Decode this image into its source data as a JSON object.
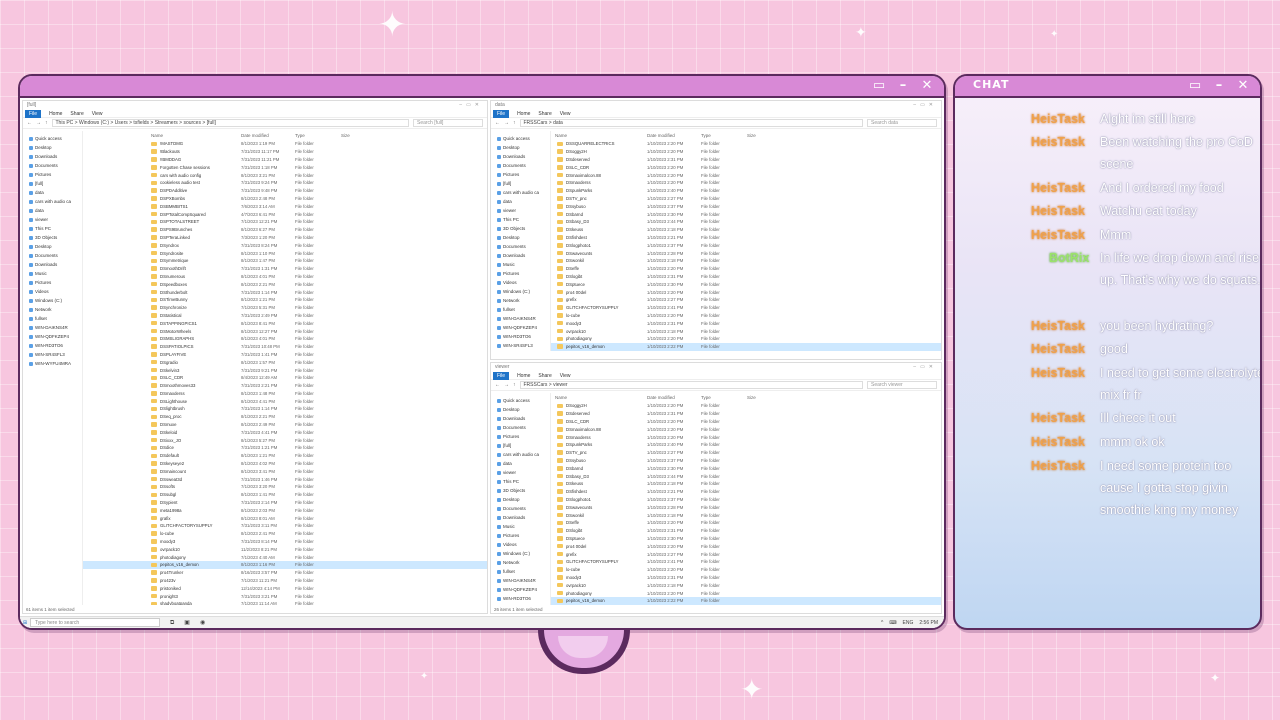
{
  "sparkles": [
    "✦",
    "✦",
    "✦",
    "✦",
    "✦",
    "✦"
  ],
  "screen_frame": {
    "buttons": [
      "▭",
      "–",
      "✕"
    ]
  },
  "chat_frame": {
    "title": "CHAT",
    "buttons": [
      "▭",
      "–",
      "✕"
    ]
  },
  "colors": {
    "username": "#f0a24a",
    "bot_username": "#9be36b",
    "frame": "#5b2a5e",
    "titlebar": "#d889d6",
    "background": "#f7c6df"
  },
  "left_explorer": {
    "title": "[full]",
    "ribbon": {
      "file": "File",
      "tabs": [
        "Home",
        "Share",
        "View"
      ]
    },
    "path": "This PC > Windows (C:) > Users > tsfields > Streamers > sources > [full]",
    "search": "Search [full]",
    "columns": {
      "name": "Name",
      "date": "Date modified",
      "type": "Type",
      "size": "Size"
    },
    "nav": [
      "Quick access",
      "Desktop",
      "Downloads",
      "Documents",
      "Pictures",
      "[full]",
      "data",
      "cars with audio ca",
      "data",
      "viewer",
      "This PC",
      "3D Objects",
      "Desktop",
      "Documents",
      "Downloads",
      "Music",
      "Pictures",
      "Videos",
      "Windows (C:)",
      "Network",
      "fullset",
      "WIN-DAIKNS4R",
      "WIN-QDFKZEP4",
      "WIN-RD3TO6",
      "WIN-SR4SFL3",
      "WIN-WYFU4MRA"
    ],
    "rows": [
      {
        "name": "!MASTDMG",
        "date": "8/1/2023 1:19 PM",
        "type": "File folder"
      },
      {
        "name": "!Blackouts",
        "date": "7/31/2023 11:17 PM",
        "type": "File folder"
      },
      {
        "name": "!!BMDDAG",
        "date": "7/31/2023 11:21 PM",
        "type": "File folder"
      },
      {
        "name": "Forgotten Chase sessions",
        "date": "7/31/2023 1:18 PM",
        "type": "File folder"
      },
      {
        "name": "cars with audio config",
        "date": "8/1/2023 3:21 PM",
        "type": "File folder"
      },
      {
        "name": "cookieless audio test",
        "date": "7/31/2023 9:24 PM",
        "type": "File folder"
      },
      {
        "name": "DSPDAdditive",
        "date": "7/31/2023 9:48 PM",
        "type": "File folder"
      },
      {
        "name": "DSPXBombs",
        "date": "8/1/2023 2:48 PM",
        "type": "File folder"
      },
      {
        "name": "DSBMMBITS1",
        "date": "7/6/2023 3:14 AM",
        "type": "File folder"
      },
      {
        "name": "DSPTotalCompSquared",
        "date": "4/7/2023 6:41 PM",
        "type": "File folder"
      },
      {
        "name": "DSPTOTALSTREET",
        "date": "7/1/2023 12:21 PM",
        "type": "File folder"
      },
      {
        "name": "DSPS9Brunches",
        "date": "8/1/2023 6:27 PM",
        "type": "File folder"
      },
      {
        "name": "DSPTeraLinked",
        "date": "7/3/2023 1:20 PM",
        "type": "File folder"
      },
      {
        "name": "DSyndrox",
        "date": "7/31/2023 8:24 PM",
        "type": "File folder"
      },
      {
        "name": "DSyndrosite",
        "date": "8/1/2023 1:10 PM",
        "type": "File folder"
      },
      {
        "name": "DSymmetrique",
        "date": "8/1/2023 1:47 PM",
        "type": "File folder"
      },
      {
        "name": "DSmoothDrift",
        "date": "7/31/2023 1:31 PM",
        "type": "File folder"
      },
      {
        "name": "DSnumerous",
        "date": "8/1/2023 4:01 PM",
        "type": "File folder"
      },
      {
        "name": "DSpeedboxes",
        "date": "8/1/2023 2:21 PM",
        "type": "File folder"
      },
      {
        "name": "DSthunderbolt",
        "date": "7/31/2023 1:14 PM",
        "type": "File folder"
      },
      {
        "name": "DSTimeBunny",
        "date": "8/1/2023 1:21 PM",
        "type": "File folder"
      },
      {
        "name": "DSynchronize",
        "date": "7/1/2023 5:31 PM",
        "type": "File folder"
      },
      {
        "name": "DStatistical",
        "date": "7/31/2023 2:49 PM",
        "type": "File folder"
      },
      {
        "name": "DSTAPPINGPICS1",
        "date": "8/1/2023 8:41 PM",
        "type": "File folder"
      },
      {
        "name": "DSMotorWheels",
        "date": "8/1/2023 12:27 PM",
        "type": "File folder"
      },
      {
        "name": "DSMSLIGRAPHS",
        "date": "8/1/2023 4:01 PM",
        "type": "File folder"
      },
      {
        "name": "DSSPATIOLPICS",
        "date": "7/31/2023 10:48 PM",
        "type": "File folder"
      },
      {
        "name": "DSPLAYFIVE",
        "date": "7/31/2023 1:41 PM",
        "type": "File folder"
      },
      {
        "name": "DSgradio",
        "date": "8/1/2023 1:57 PM",
        "type": "File folder"
      },
      {
        "name": "DSkelvin3",
        "date": "7/31/2023 9:21 PM",
        "type": "File folder"
      },
      {
        "name": "DSLC_CDR",
        "date": "8/4/2023 12:49 AM",
        "type": "File folder"
      },
      {
        "name": "DSmoothmoves33",
        "date": "7/31/2023 2:21 PM",
        "type": "File folder"
      },
      {
        "name": "DSmaxderss",
        "date": "8/1/2023 1:48 PM",
        "type": "File folder"
      },
      {
        "name": "DSLighthouse",
        "date": "8/1/2023 4:41 PM",
        "type": "File folder"
      },
      {
        "name": "DSlightbrush",
        "date": "7/31/2023 1:14 PM",
        "type": "File folder"
      },
      {
        "name": "DSeq_proc",
        "date": "8/1/2023 2:21 PM",
        "type": "File folder"
      },
      {
        "name": "DSmuxe",
        "date": "8/1/2023 2:49 PM",
        "type": "File folder"
      },
      {
        "name": "DSkeloid",
        "date": "7/31/2023 4:41 PM",
        "type": "File folder"
      },
      {
        "name": "DSixxx_JO",
        "date": "8/1/2023 5:27 PM",
        "type": "File folder"
      },
      {
        "name": "DSdice",
        "date": "7/31/2023 1:21 PM",
        "type": "File folder"
      },
      {
        "name": "DSdefault",
        "date": "8/1/2023 1:21 PM",
        "type": "File folder"
      },
      {
        "name": "DSkeyseye2",
        "date": "8/1/2023 4:02 PM",
        "type": "File folder"
      },
      {
        "name": "DSmaincount",
        "date": "8/1/2023 3:41 PM",
        "type": "File folder"
      },
      {
        "name": "DSsweat3d",
        "date": "7/31/2023 1:46 PM",
        "type": "File folder"
      },
      {
        "name": "DSsofts",
        "date": "7/1/2023 3:20 PM",
        "type": "File folder"
      },
      {
        "name": "DSsubgl",
        "date": "8/1/2023 1:41 PM",
        "type": "File folder"
      },
      {
        "name": "DSypient",
        "date": "7/31/2023 2:14 PM",
        "type": "File folder"
      },
      {
        "name": "meta1998a",
        "date": "8/1/2023 2:03 PM",
        "type": "File folder"
      },
      {
        "name": "grafix",
        "date": "8/1/2023 8:01 AM",
        "type": "File folder"
      },
      {
        "name": "GLITCHFACTORYSUPPLY",
        "date": "7/31/2023 3:11 PM",
        "type": "File folder"
      },
      {
        "name": "lo-cube",
        "date": "8/1/2023 2:41 PM",
        "type": "File folder"
      },
      {
        "name": "moody3",
        "date": "7/31/2023 8:14 PM",
        "type": "File folder"
      },
      {
        "name": "ovrpack10",
        "date": "11/2/2023 8:21 PM",
        "type": "File folder"
      },
      {
        "name": "photodiagony",
        "date": "7/1/2023 4:40 AM",
        "type": "File folder"
      },
      {
        "name": "pepitos_v16_demon",
        "date": "8/1/2023 1:16 PM",
        "type": "File folder",
        "selected": true
      },
      {
        "name": "pro4Trunker",
        "date": "8/16/2023 3:57 PM",
        "type": "File folder"
      },
      {
        "name": "pro423v",
        "date": "7/1/2023 11:21 PM",
        "type": "File folder"
      },
      {
        "name": "pristoniked",
        "date": "12/14/2023 4:14 PM",
        "type": "File folder"
      },
      {
        "name": "pronight3",
        "date": "7/31/2023 3:21 PM",
        "type": "File folder"
      },
      {
        "name": "shadyboatpanda",
        "date": "7/1/2023 11:14 AM",
        "type": "File folder"
      }
    ],
    "status": "61 items   1 item selected"
  },
  "right_top_explorer": {
    "title": "data",
    "ribbon": {
      "file": "File",
      "tabs": [
        "Home",
        "Share",
        "View"
      ]
    },
    "path": "FRSSCars > data",
    "search": "Search data",
    "columns": {
      "name": "Name",
      "date": "Date modified",
      "type": "Type",
      "size": "Size"
    },
    "nav": [
      "Quick access",
      "Desktop",
      "Downloads",
      "Documents",
      "Pictures",
      "[full]",
      "cars with audio ca",
      "data",
      "viewer",
      "This PC",
      "3D Objects",
      "Desktop",
      "Documents",
      "Downloads",
      "Music",
      "Pictures",
      "Videos",
      "Windows (C:)",
      "Network",
      "fullset",
      "WIN-DAIKNS4R",
      "WIN-QDFKZEP4",
      "WIN-RD3TO6",
      "WIN-SR4SFL3"
    ],
    "rows": [
      {
        "name": "DSSQUARRELECTRICS",
        "date": "1/10/2023 2:20 PM",
        "type": "File folder"
      },
      {
        "name": "DSoggy2H",
        "date": "1/10/2023 2:20 PM",
        "type": "File folder"
      },
      {
        "name": "DSdeserved",
        "date": "1/10/2023 2:31 PM",
        "type": "File folder"
      },
      {
        "name": "DSLC_CDR",
        "date": "1/10/2023 2:20 PM",
        "type": "File folder"
      },
      {
        "name": "DSmaximalcon.88",
        "date": "1/10/2023 2:20 PM",
        "type": "File folder"
      },
      {
        "name": "DSmaxderss",
        "date": "1/10/2023 2:20 PM",
        "type": "File folder"
      },
      {
        "name": "DSpunkParks",
        "date": "1/10/2023 2:40 PM",
        "type": "File folder"
      },
      {
        "name": "DSTV_pnc",
        "date": "1/10/2023 2:27 PM",
        "type": "File folder"
      },
      {
        "name": "DSsybuso",
        "date": "1/10/2023 2:37 PM",
        "type": "File folder"
      },
      {
        "name": "DSbarnd",
        "date": "1/10/2023 2:30 PM",
        "type": "File folder"
      },
      {
        "name": "DSbasy_D3",
        "date": "1/10/2023 2:44 PM",
        "type": "File folder"
      },
      {
        "name": "DSkeuss",
        "date": "1/10/2023 2:18 PM",
        "type": "File folder"
      },
      {
        "name": "DSfishdest",
        "date": "1/10/2023 2:21 PM",
        "type": "File folder"
      },
      {
        "name": "DSlogphoto1",
        "date": "1/10/2023 2:37 PM",
        "type": "File folder"
      },
      {
        "name": "DSwavecunts",
        "date": "1/10/2023 2:28 PM",
        "type": "File folder"
      },
      {
        "name": "DSwonkil",
        "date": "1/10/2023 2:18 PM",
        "type": "File folder"
      },
      {
        "name": "DSeffe",
        "date": "1/10/2023 2:20 PM",
        "type": "File folder"
      },
      {
        "name": "DSlogibt",
        "date": "1/10/2023 2:31 PM",
        "type": "File folder"
      },
      {
        "name": "DSptuece",
        "date": "1/10/2023 2:30 PM",
        "type": "File folder"
      },
      {
        "name": "pro4 00del",
        "date": "1/10/2023 2:20 PM",
        "type": "File folder"
      },
      {
        "name": "grefix",
        "date": "1/10/2023 2:27 PM",
        "type": "File folder"
      },
      {
        "name": "GLITCHFACTORYSUPPLY",
        "date": "1/10/2023 2:41 PM",
        "type": "File folder"
      },
      {
        "name": "lo-cube",
        "date": "1/10/2023 2:20 PM",
        "type": "File folder"
      },
      {
        "name": "moody3",
        "date": "1/10/2023 2:31 PM",
        "type": "File folder"
      },
      {
        "name": "ovrpack10",
        "date": "1/10/2023 2:18 PM",
        "type": "File folder"
      },
      {
        "name": "photodiagony",
        "date": "1/10/2023 2:20 PM",
        "type": "File folder"
      },
      {
        "name": "pepitos_v16_demon",
        "date": "1/10/2023 2:22 PM",
        "type": "File folder",
        "selected": true
      }
    ]
  },
  "right_bottom_explorer": {
    "title": "viewer",
    "ribbon": {
      "file": "File",
      "tabs": [
        "Home",
        "Share",
        "View"
      ]
    },
    "path": "FRSSCars > viewer",
    "search": "Search viewer",
    "columns": {
      "name": "Name",
      "date": "Date modified",
      "type": "Type",
      "size": "Size"
    },
    "nav": [
      "Quick access",
      "Desktop",
      "Downloads",
      "Documents",
      "Pictures",
      "[full]",
      "cars with audio ca",
      "data",
      "viewer",
      "This PC",
      "3D Objects",
      "Desktop",
      "Documents",
      "Downloads",
      "Music",
      "Pictures",
      "Videos",
      "Windows (C:)",
      "Network",
      "fullset",
      "WIN-DAIKNS4R",
      "WIN-QDFKZEP4",
      "WIN-RD3TO6"
    ],
    "rows": [
      {
        "name": "DSoggy2H",
        "date": "1/10/2023 2:20 PM",
        "type": "File folder"
      },
      {
        "name": "DSdeserved",
        "date": "1/10/2023 2:31 PM",
        "type": "File folder"
      },
      {
        "name": "DSLC_CDR",
        "date": "1/10/2023 2:20 PM",
        "type": "File folder"
      },
      {
        "name": "DSmaximalcon.88",
        "date": "1/10/2023 2:20 PM",
        "type": "File folder"
      },
      {
        "name": "DSmaxderss",
        "date": "1/10/2023 2:20 PM",
        "type": "File folder"
      },
      {
        "name": "DSpunkParks",
        "date": "1/10/2023 2:40 PM",
        "type": "File folder"
      },
      {
        "name": "DSTV_pnc",
        "date": "1/10/2023 2:27 PM",
        "type": "File folder"
      },
      {
        "name": "DSsybuso",
        "date": "1/10/2023 2:37 PM",
        "type": "File folder"
      },
      {
        "name": "DSbarnd",
        "date": "1/10/2023 2:30 PM",
        "type": "File folder"
      },
      {
        "name": "DSbasy_D3",
        "date": "1/10/2023 2:44 PM",
        "type": "File folder"
      },
      {
        "name": "DSkeuss",
        "date": "1/10/2023 2:18 PM",
        "type": "File folder"
      },
      {
        "name": "DSfishdest",
        "date": "1/10/2023 2:21 PM",
        "type": "File folder"
      },
      {
        "name": "DSlogphoto1",
        "date": "1/10/2023 2:37 PM",
        "type": "File folder"
      },
      {
        "name": "DSwavecunts",
        "date": "1/10/2023 2:28 PM",
        "type": "File folder"
      },
      {
        "name": "DSwonkil",
        "date": "1/10/2023 2:18 PM",
        "type": "File folder"
      },
      {
        "name": "DSeffe",
        "date": "1/10/2023 2:20 PM",
        "type": "File folder"
      },
      {
        "name": "DSlogibt",
        "date": "1/10/2023 2:31 PM",
        "type": "File folder"
      },
      {
        "name": "DSptuece",
        "date": "1/10/2023 2:30 PM",
        "type": "File folder"
      },
      {
        "name": "pro4 00del",
        "date": "1/10/2023 2:20 PM",
        "type": "File folder"
      },
      {
        "name": "grefix",
        "date": "1/10/2023 2:27 PM",
        "type": "File folder"
      },
      {
        "name": "GLITCHFACTORYSUPPLY",
        "date": "1/10/2023 2:41 PM",
        "type": "File folder"
      },
      {
        "name": "lo-cube",
        "date": "1/10/2023 2:20 PM",
        "type": "File folder"
      },
      {
        "name": "moody3",
        "date": "1/10/2023 2:31 PM",
        "type": "File folder"
      },
      {
        "name": "ovrpack10",
        "date": "1/10/2023 2:18 PM",
        "type": "File folder"
      },
      {
        "name": "photodiagony",
        "date": "1/10/2023 2:20 PM",
        "type": "File folder"
      },
      {
        "name": "pepitos_v16_demon",
        "date": "1/10/2023 2:22 PM",
        "type": "File folder",
        "selected": true
      }
    ],
    "status": "26 items   1 item selected"
  },
  "taskbar": {
    "start": "⊞",
    "search_placeholder": "Type here to search",
    "icons": [
      "⧉",
      "▣",
      "◉"
    ],
    "tray": [
      "^",
      "⌨",
      "ENG",
      "2:56 PM"
    ]
  },
  "chat": {
    "messages": [
      {
        "user": "HeisTask",
        "text": "Alght im still here"
      },
      {
        "user": "HeisTask",
        "text": "Been watching the pro CoD scene"
      },
      {
        "user": "HeisTask",
        "text": "And I ordered my food"
      },
      {
        "user": "HeisTask",
        "text": "Watchu eat today"
      },
      {
        "user": "HeisTask",
        "text": "Mmm"
      },
      {
        "user": "BotRix",
        "text": "In life we drop down and rise up. That's why we do squats.",
        "bot": true
      },
      {
        "user": "HeisTask",
        "text": "you been hydrating?"
      },
      {
        "user": "HeisTask",
        "text": "good"
      },
      {
        "user": "HeisTask",
        "text": "I need to get some electrolyte mix fr fr"
      },
      {
        "user": "HeisTask",
        "text": "Ill checc it out"
      },
      {
        "user": "HeisTask",
        "text": "mmm ok ok"
      },
      {
        "user": "HeisTask",
        "text": "I need some protein too cause I gotta stop givin smoothie king my money"
      }
    ]
  }
}
